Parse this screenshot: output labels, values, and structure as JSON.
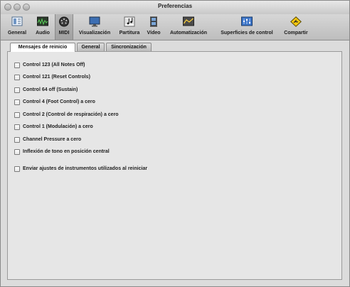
{
  "window": {
    "title": "Preferencias"
  },
  "toolbar": {
    "items": [
      {
        "label": "General",
        "icon": "general-icon"
      },
      {
        "label": "Audio",
        "icon": "audio-icon"
      },
      {
        "label": "MIDI",
        "icon": "midi-icon",
        "selected": true
      },
      {
        "label": "Visualización",
        "icon": "display-icon"
      },
      {
        "label": "Partitura",
        "icon": "score-icon"
      },
      {
        "label": "Vídeo",
        "icon": "video-icon"
      },
      {
        "label": "Automatización",
        "icon": "automation-icon"
      },
      {
        "label": "Superficies de control",
        "icon": "control-surfaces-icon"
      },
      {
        "label": "Compartir",
        "icon": "share-icon"
      }
    ]
  },
  "tabs": [
    {
      "label": "Mensajes de reinicio",
      "active": true
    },
    {
      "label": "General",
      "active": false
    },
    {
      "label": "Sincronización",
      "active": false
    }
  ],
  "options": [
    {
      "label": "Control 123 (All Notes Off)",
      "checked": false
    },
    {
      "label": "Control 121 (Reset Controls)",
      "checked": false
    },
    {
      "label": "Control 64 off (Sustain)",
      "checked": false
    },
    {
      "label": "Control 4 (Foot Control) a cero",
      "checked": false
    },
    {
      "label": "Control 2 (Control de respiración) a cero",
      "checked": false
    },
    {
      "label": "Control 1 (Modulación) a cero",
      "checked": false
    },
    {
      "label": "Channel Pressure a cero",
      "checked": false
    },
    {
      "label": "Inflexión de tono en posición central",
      "checked": false
    },
    {
      "label": "Enviar ajustes de instrumentos utilizados al reiniciar",
      "checked": false
    }
  ],
  "colors": {
    "window_bg": "#dcdcdc",
    "panel_bg": "#e6e6e6",
    "selected_toolbar": "#a8a8a8"
  }
}
